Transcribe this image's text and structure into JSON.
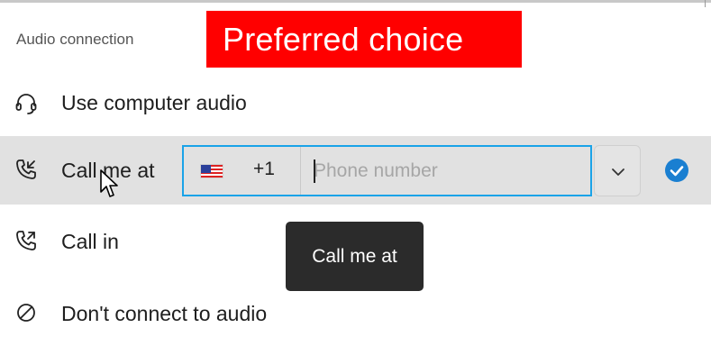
{
  "header": {
    "section_label": "Audio connection",
    "annotation_banner": "Preferred choice"
  },
  "options": {
    "computer_audio": {
      "label": "Use computer audio",
      "icon": "headset-icon"
    },
    "call_me": {
      "label": "Call me at",
      "icon": "phone-outgoing-icon",
      "country_flag": "us-flag-icon",
      "dial_code": "+1",
      "phone_placeholder": "Phone number",
      "phone_value": "",
      "dropdown_icon": "chevron-down-icon",
      "selected_icon": "checkmark-circle-icon",
      "selected": true
    },
    "call_in": {
      "label": "Call in",
      "icon": "phone-incoming-icon"
    },
    "no_audio": {
      "label": "Don't connect to audio",
      "icon": "prohibited-icon"
    }
  },
  "tooltip": {
    "text": "Call me at"
  },
  "colors": {
    "banner_bg": "#ff0000",
    "focus_border": "#1aa3e8",
    "check_fill": "#1a7fd1",
    "selected_row_bg": "#e1e1e1",
    "tooltip_bg": "#2b2b2b"
  }
}
